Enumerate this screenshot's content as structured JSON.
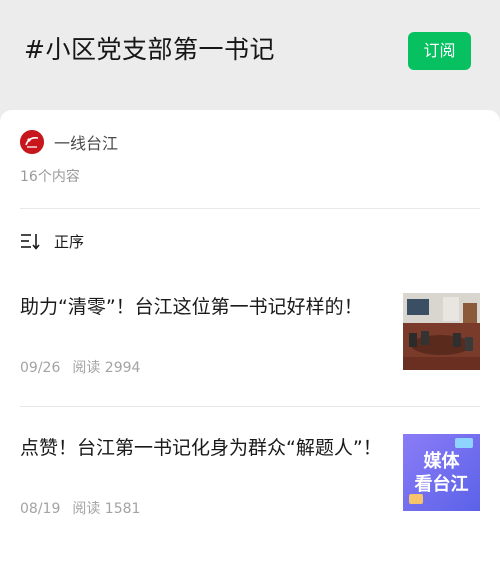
{
  "header": {
    "title": "#小区党支部第一书记",
    "subscribe_label": "订阅"
  },
  "account": {
    "name": "一线台江",
    "content_count": "16个内容"
  },
  "sort": {
    "label": "正序"
  },
  "articles": [
    {
      "title": "助力“清零”！台江这位第一书记好样的！",
      "date": "09/26",
      "reads": "阅读 2994",
      "thumb_icon": "meeting-room-photo"
    },
    {
      "title": "点赞！台江第一书记化身为群众“解题人”！",
      "date": "08/19",
      "reads": "阅读 1581",
      "thumb_icon": "media-banner",
      "thumb_text_line1": "媒体",
      "thumb_text_line2": "看台江"
    }
  ],
  "colors": {
    "accent": "#07c160",
    "avatar": "#c8161d",
    "banner": "#7a6cf0"
  }
}
